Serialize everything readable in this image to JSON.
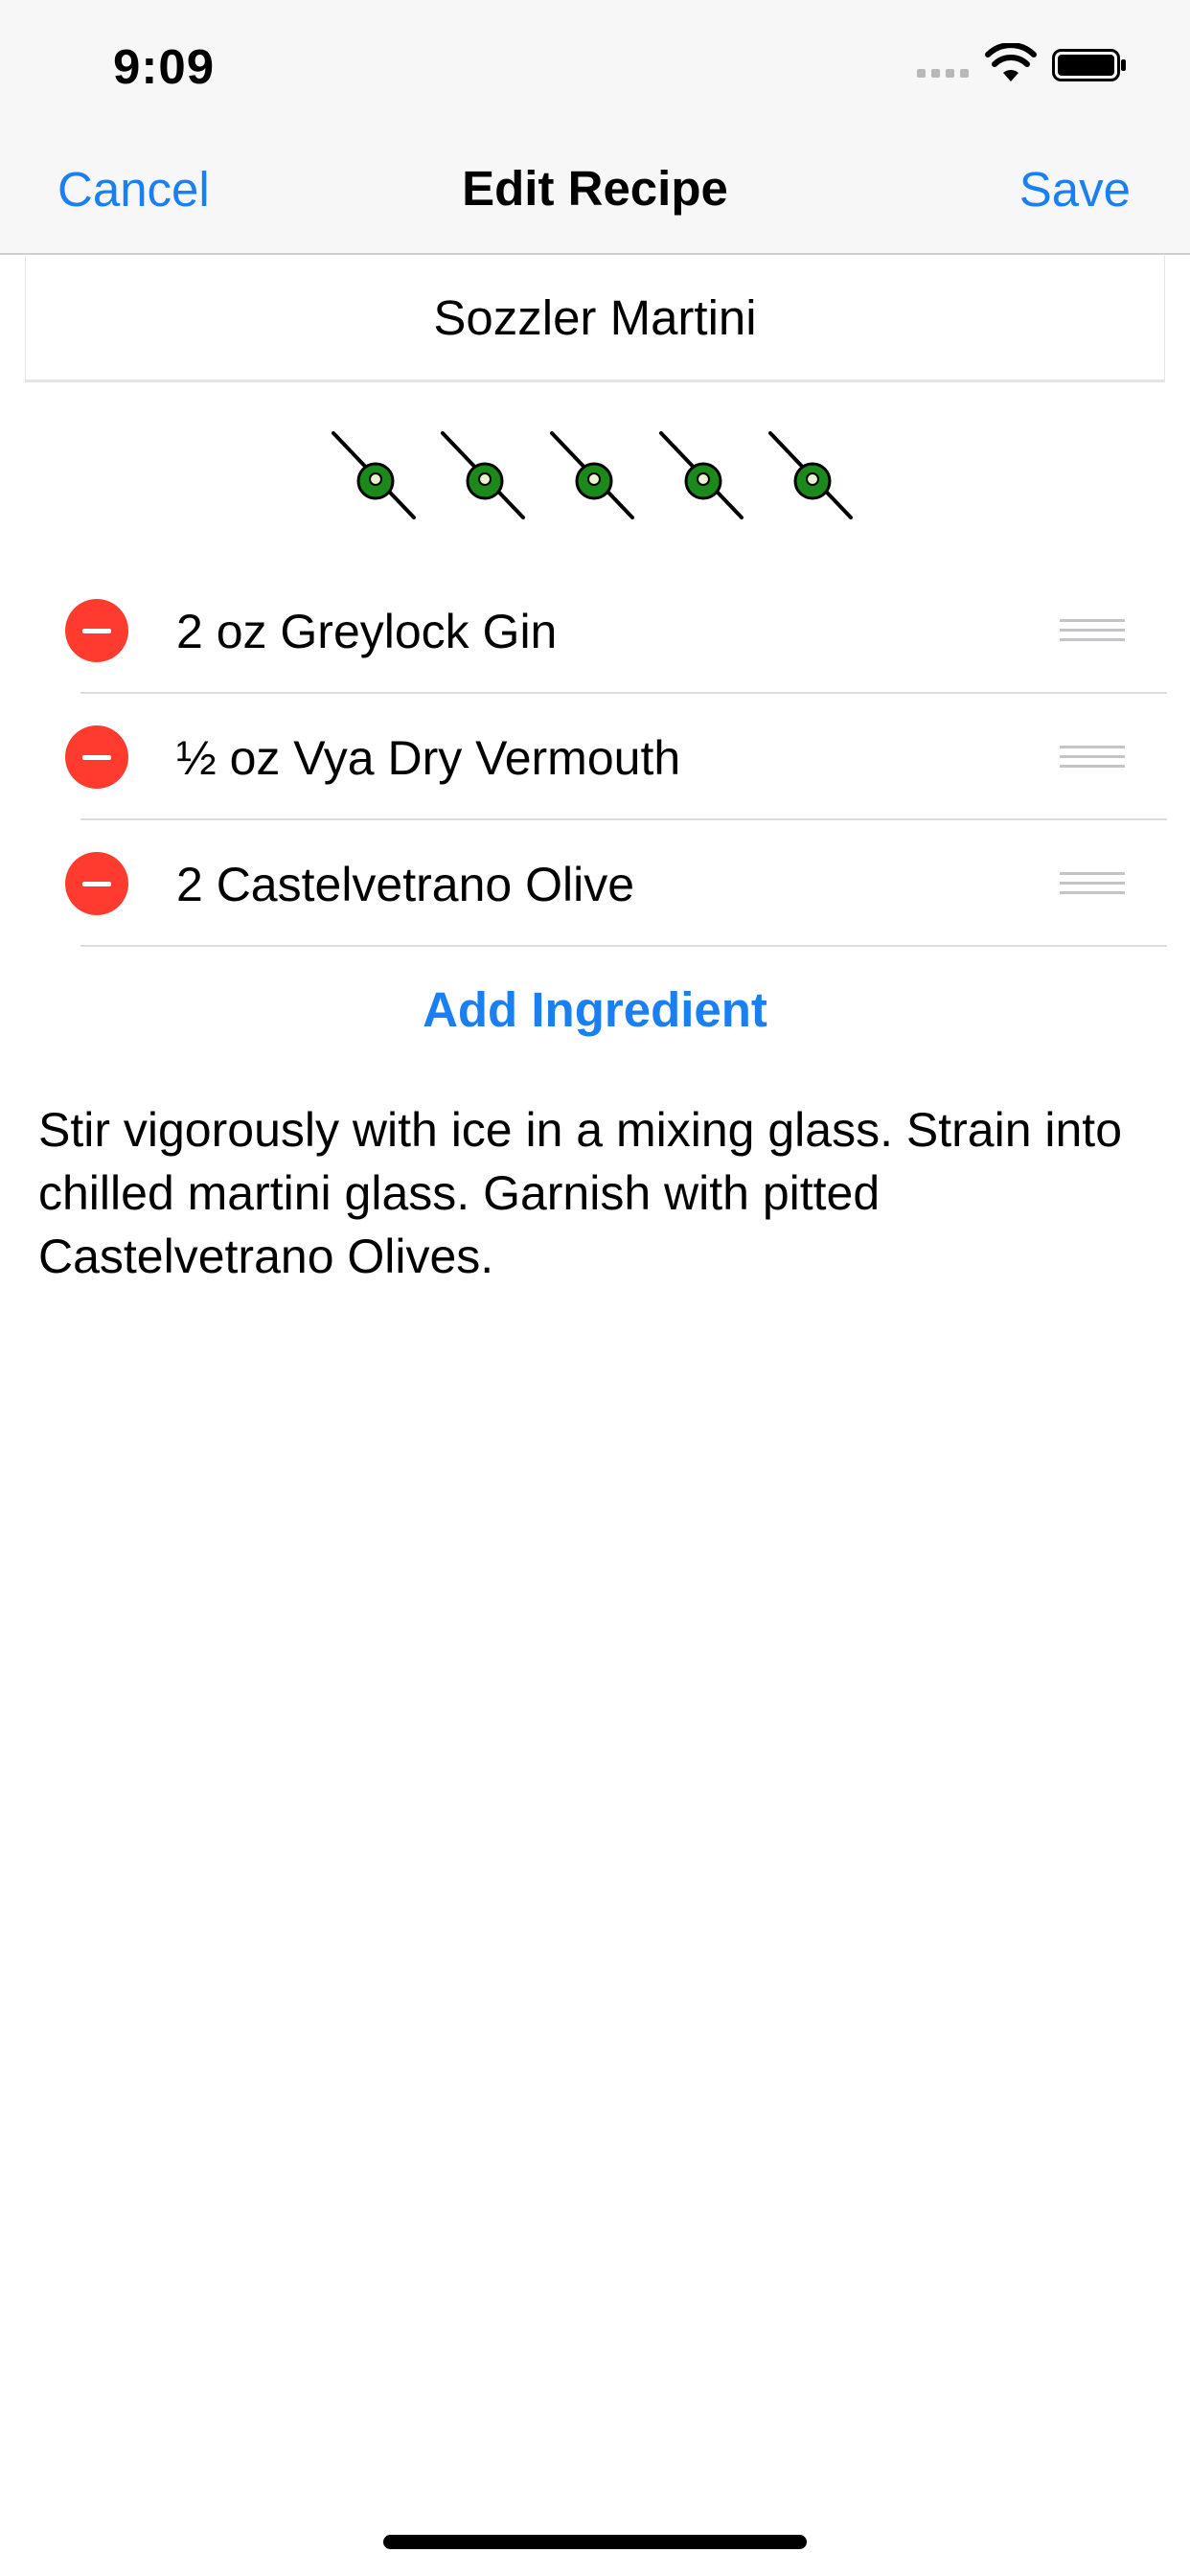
{
  "status_bar": {
    "time": "9:09"
  },
  "nav": {
    "cancel_label": "Cancel",
    "title": "Edit Recipe",
    "save_label": "Save"
  },
  "recipe": {
    "name": "Sozzler Martini",
    "rating": {
      "value": 5,
      "max": 5,
      "icon": "olive-icon",
      "color": "#1b8a1b"
    },
    "ingredients": [
      {
        "text": "2 oz Greylock Gin"
      },
      {
        "text": "½ oz Vya Dry Vermouth"
      },
      {
        "text": "2 Castelvetrano Olive"
      }
    ],
    "add_ingredient_label": "Add Ingredient",
    "instructions": "Stir vigorously with ice in a mixing glass. Strain into chilled martini glass. Garnish with pitted Castelvetrano Olives."
  },
  "colors": {
    "accent": "#1a7ff0",
    "delete": "#ff3b30",
    "olive": "#1b8a1b"
  }
}
